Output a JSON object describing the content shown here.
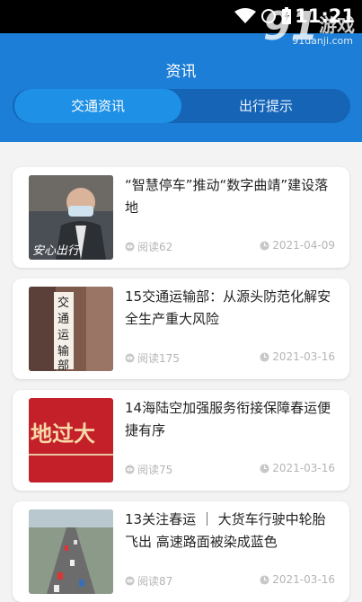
{
  "status": {
    "time": "11:21"
  },
  "watermark": {
    "title": "游戏",
    "site": "91danji.com",
    "logo": "91"
  },
  "header": {
    "title": "资讯"
  },
  "tabs": [
    {
      "label": "交通资讯",
      "active": true
    },
    {
      "label": "出行提示",
      "active": false
    }
  ],
  "news": [
    {
      "title": "“智慧停车”推动“数字曲靖”建设落地",
      "reads": "阅读62",
      "date": "2021-04-09",
      "thumb_caption": "安心出行"
    },
    {
      "title": "15交通运输部：从源头防范化解安全生产重大风险",
      "reads": "阅读175",
      "date": "2021-03-16",
      "thumb_caption": "交通运输部"
    },
    {
      "title": "14海陆空加强服务衔接保障春运便捷有序",
      "reads": "阅读75",
      "date": "2021-03-16",
      "thumb_caption": "地过大"
    },
    {
      "title": "13关注春运 ｜ 大货车行驶中轮胎飞出 高速路面被染成蓝色",
      "reads": "阅读87",
      "date": "2021-03-16",
      "thumb_caption": ""
    }
  ],
  "colors": {
    "brand": "#1c7ed6",
    "tab_active": "#1e90e6",
    "tab_track": "#1564b6"
  }
}
